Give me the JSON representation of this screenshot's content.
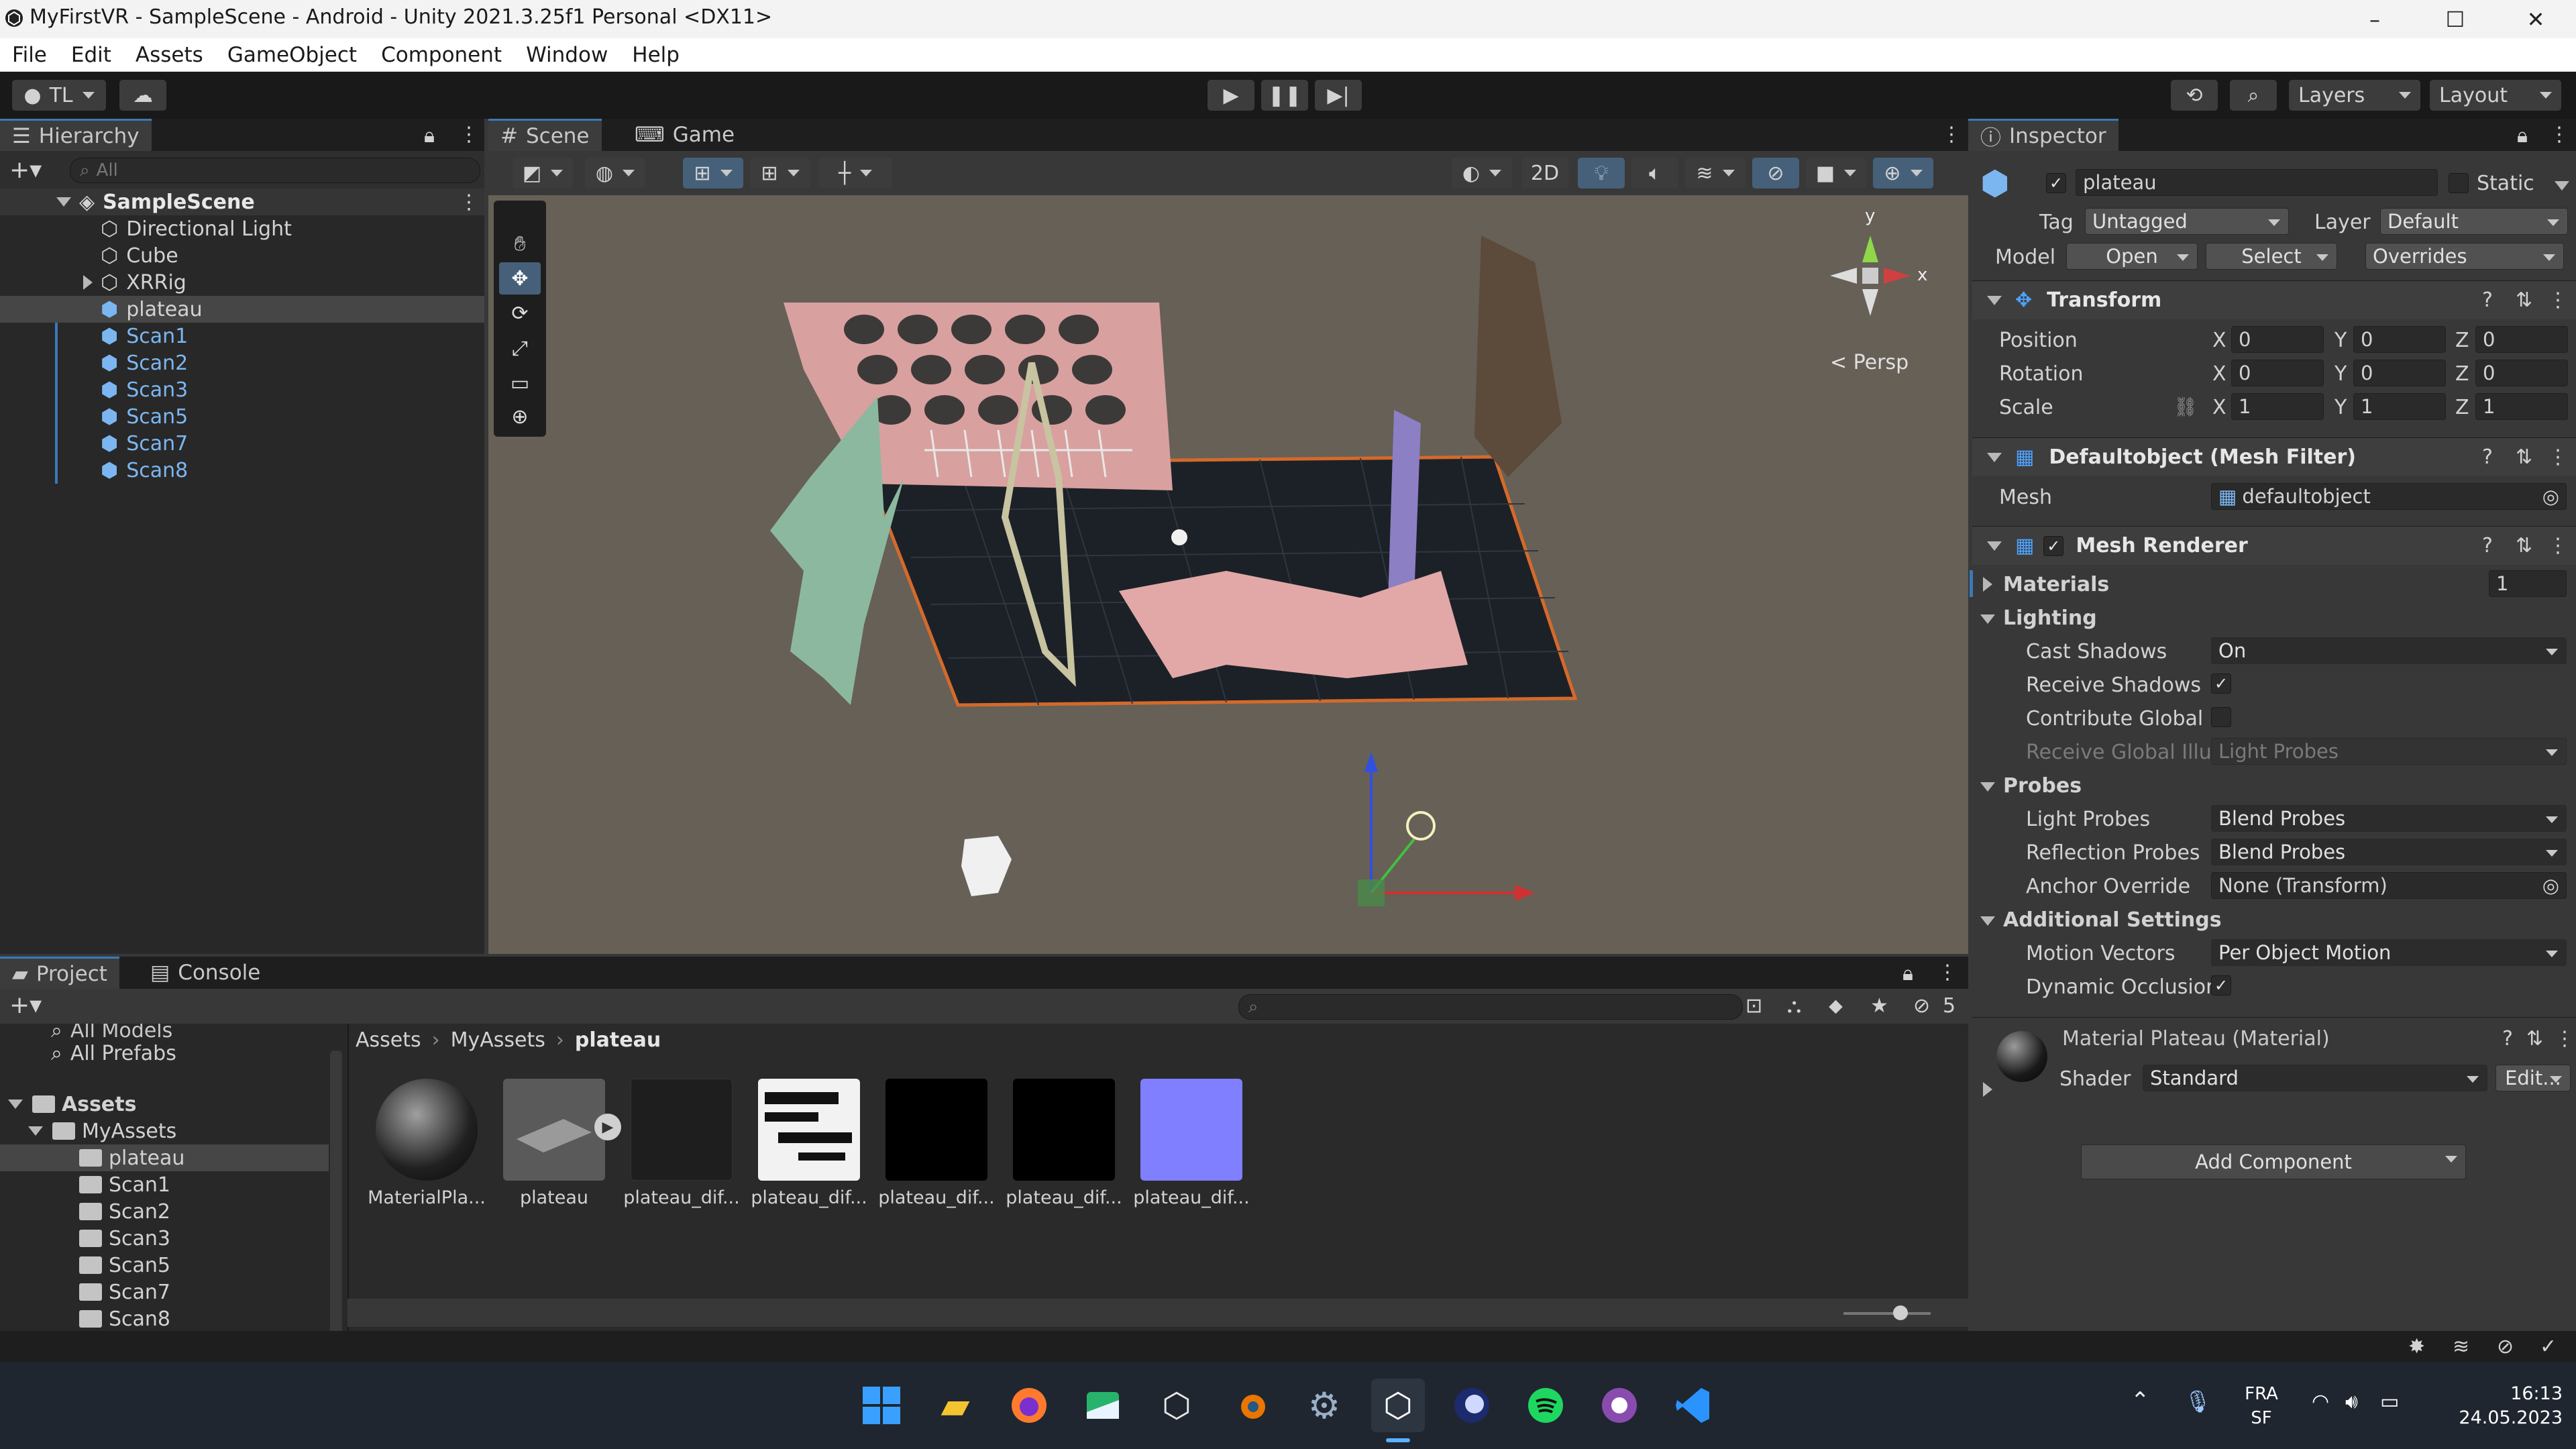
{
  "window": {
    "title": "MyFirstVR - SampleScene - Android - Unity 2021.3.25f1 Personal <DX11>",
    "controls": [
      "–",
      "☐",
      "✕"
    ]
  },
  "menu": [
    "File",
    "Edit",
    "Assets",
    "GameObject",
    "Component",
    "Window",
    "Help"
  ],
  "toolbar": {
    "account": "TL",
    "layers": "Layers",
    "layout": "Layout"
  },
  "hierarchy": {
    "tab": "Hierarchy",
    "search_placeholder": "All",
    "scene": "SampleScene",
    "items": [
      {
        "label": "Directional Light",
        "blue": false
      },
      {
        "label": "Cube",
        "blue": false
      },
      {
        "label": "XRRig",
        "blue": false
      },
      {
        "label": "plateau",
        "blue": false
      },
      {
        "label": "Scan1",
        "blue": true
      },
      {
        "label": "Scan2",
        "blue": true
      },
      {
        "label": "Scan3",
        "blue": true
      },
      {
        "label": "Scan5",
        "blue": true
      },
      {
        "label": "Scan7",
        "blue": true
      },
      {
        "label": "Scan8",
        "blue": true
      }
    ]
  },
  "scene": {
    "tabs": [
      "Scene",
      "Game"
    ],
    "btn_2d": "2D",
    "persp": "< Persp",
    "gizmo_y": "y",
    "gizmo_x": "x"
  },
  "inspector": {
    "tab": "Inspector",
    "object_name": "plateau",
    "static_label": "Static",
    "tag_label": "Tag",
    "tag_value": "Untagged",
    "layer_label": "Layer",
    "layer_value": "Default",
    "model_label": "Model",
    "open_btn": "Open",
    "select_btn": "Select",
    "overrides": "Overrides",
    "transform": {
      "title": "Transform",
      "position": "Position",
      "rotation": "Rotation",
      "scale": "Scale",
      "pos": [
        "0",
        "0",
        "0"
      ],
      "rot": [
        "0",
        "0",
        "0"
      ],
      "scl": [
        "1",
        "1",
        "1"
      ],
      "axes": [
        "X",
        "Y",
        "Z"
      ]
    },
    "mesh_filter": {
      "title": "Defaultobject (Mesh Filter)",
      "mesh_label": "Mesh",
      "mesh_value": "defaultobject"
    },
    "mesh_renderer": {
      "title": "Mesh Renderer",
      "materials": "Materials",
      "materials_count": "1",
      "lighting": "Lighting",
      "cast_shadows": "Cast Shadows",
      "cast_shadows_value": "On",
      "receive_shadows": "Receive Shadows",
      "contribute_gi": "Contribute Global I",
      "receive_gi": "Receive Global Illu",
      "receive_gi_value": "Light Probes",
      "probes": "Probes",
      "light_probes": "Light Probes",
      "light_probes_value": "Blend Probes",
      "reflection_probes": "Reflection Probes",
      "reflection_probes_value": "Blend Probes",
      "anchor_override": "Anchor Override",
      "anchor_override_value": "None (Transform)",
      "additional_settings": "Additional Settings",
      "motion_vectors": "Motion Vectors",
      "motion_vectors_value": "Per Object Motion",
      "dynamic_occlusion": "Dynamic Occlusior"
    },
    "material": {
      "title": "Material Plateau (Material)",
      "shader_label": "Shader",
      "shader_value": "Standard",
      "edit_btn": "Edit..."
    },
    "add_component": "Add Component"
  },
  "project": {
    "tabs": [
      "Project",
      "Console"
    ],
    "hidden_count": "5",
    "favorites": [
      "All Models",
      "All Prefabs"
    ],
    "assets_root": "Assets",
    "my_assets": "MyAssets",
    "folders": [
      "plateau",
      "Scan1",
      "Scan2",
      "Scan3",
      "Scan5",
      "Scan7",
      "Scan8"
    ],
    "breadcrumb": [
      "Assets",
      "MyAssets",
      "plateau"
    ],
    "items": [
      "MaterialPla...",
      "plateau",
      "plateau_dif...",
      "plateau_dif...",
      "plateau_dif...",
      "plateau_dif...",
      "plateau_dif..."
    ]
  },
  "taskbar": {
    "lang1": "FRA",
    "lang2": "SF",
    "time": "16:13",
    "date": "24.05.2023"
  },
  "colors": {
    "accent": "#3a79bb",
    "selection": "#2c5d87",
    "prefab_blue": "#7cb6f1",
    "scene_bg": "#666056"
  }
}
